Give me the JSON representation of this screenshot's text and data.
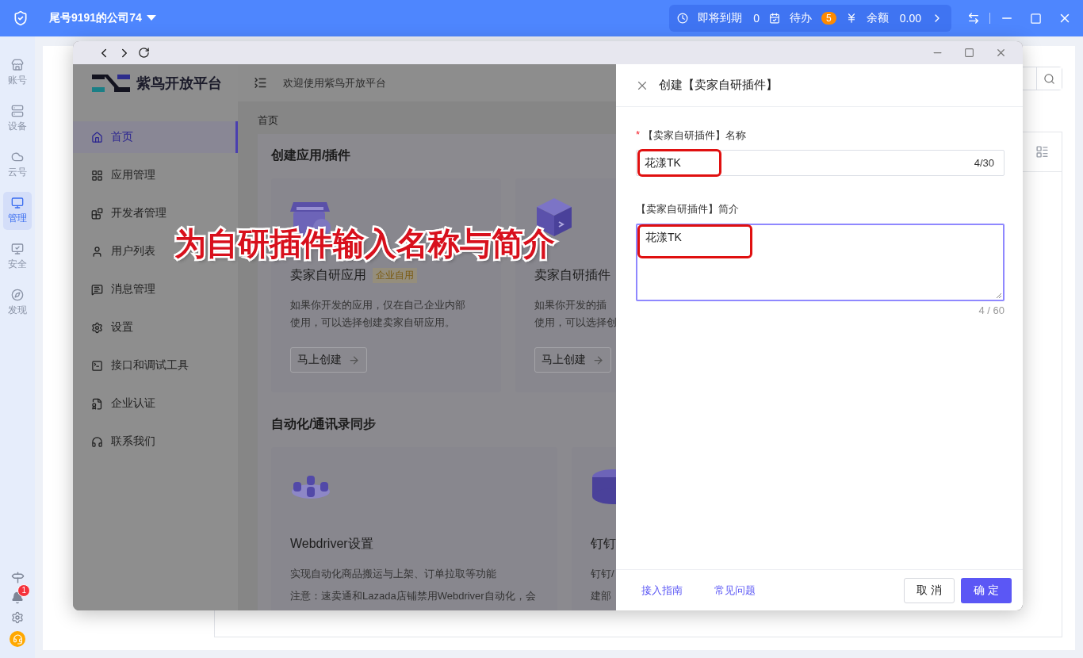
{
  "top_bar": {
    "company": "尾号9191的公司74",
    "stats": [
      {
        "kind": "expiring",
        "label": "即将到期",
        "value": "0"
      },
      {
        "kind": "todo",
        "label": "待办",
        "badge": "5"
      },
      {
        "kind": "balance",
        "label": "余额",
        "value": "0.00"
      }
    ]
  },
  "rail": {
    "items": [
      {
        "kind": "account",
        "label": "账号",
        "selected": false
      },
      {
        "kind": "device",
        "label": "设备",
        "selected": false
      },
      {
        "kind": "cloud",
        "label": "云号",
        "selected": false
      },
      {
        "kind": "manage",
        "label": "管理",
        "selected": true
      },
      {
        "kind": "security",
        "label": "安全",
        "selected": false
      },
      {
        "kind": "discover",
        "label": "发现",
        "selected": false
      }
    ],
    "notification_badge": "1"
  },
  "platform": {
    "logo_text": "紫鸟开放平台",
    "welcome": "欢迎使用紫鸟开放平台",
    "breadcrumb": "首页",
    "nav": [
      {
        "kind": "home",
        "label": "首页",
        "selected": true
      },
      {
        "kind": "apps",
        "label": "应用管理",
        "selected": false
      },
      {
        "kind": "developers",
        "label": "开发者管理",
        "selected": false
      },
      {
        "kind": "users",
        "label": "用户列表",
        "selected": false
      },
      {
        "kind": "messages",
        "label": "消息管理",
        "selected": false
      },
      {
        "kind": "settings",
        "label": "设置",
        "selected": false
      },
      {
        "kind": "api",
        "label": "接口和调试工具",
        "selected": false
      },
      {
        "kind": "certification",
        "label": "企业认证",
        "selected": false
      },
      {
        "kind": "contact",
        "label": "联系我们",
        "selected": false
      }
    ],
    "sections": [
      {
        "title": "创建应用/插件",
        "cards": [
          {
            "kind": "store",
            "title": "卖家自研应用",
            "badge": "企业自用",
            "desc_lines": [
              "如果你开发的应用，仅在自己企业内部",
              "使用，可以选择创建卖家自研应用。"
            ],
            "button": "马上创建"
          },
          {
            "kind": "cube",
            "title": "卖家自研插件",
            "desc_lines": [
              "如果你开发的插",
              "使用，可以选择创"
            ],
            "button": "马上创建"
          }
        ]
      },
      {
        "title": "自动化/通讯录同步",
        "cards": [
          {
            "kind": "network",
            "title": "Webdriver设置",
            "desc_lines": [
              "实现自动化商品搬运与上架、订单拉取等功能",
              "注意：速卖通和Lazada店铺禁用Webdriver自动化，会"
            ]
          },
          {
            "kind": "disc",
            "title": "钉钉",
            "desc_lines": [
              "钉钉/",
              "建部"
            ]
          }
        ]
      }
    ]
  },
  "caption": "为自研插件输入名称与简介",
  "drawer": {
    "title": "创建【卖家自研插件】",
    "fields": [
      {
        "kind": "input",
        "required_mark": "*",
        "label": "【卖家自研插件】名称",
        "value": "花漾TK",
        "count": "4/30",
        "highlighted": true,
        "focused": false
      },
      {
        "kind": "textarea",
        "label": "【卖家自研插件】简介",
        "value": "花漾TK",
        "count": "4 / 60",
        "highlighted": true,
        "focused": true
      }
    ],
    "links": [
      "接入指南",
      "常见问题"
    ],
    "cancel": "取 消",
    "confirm": "确 定"
  }
}
